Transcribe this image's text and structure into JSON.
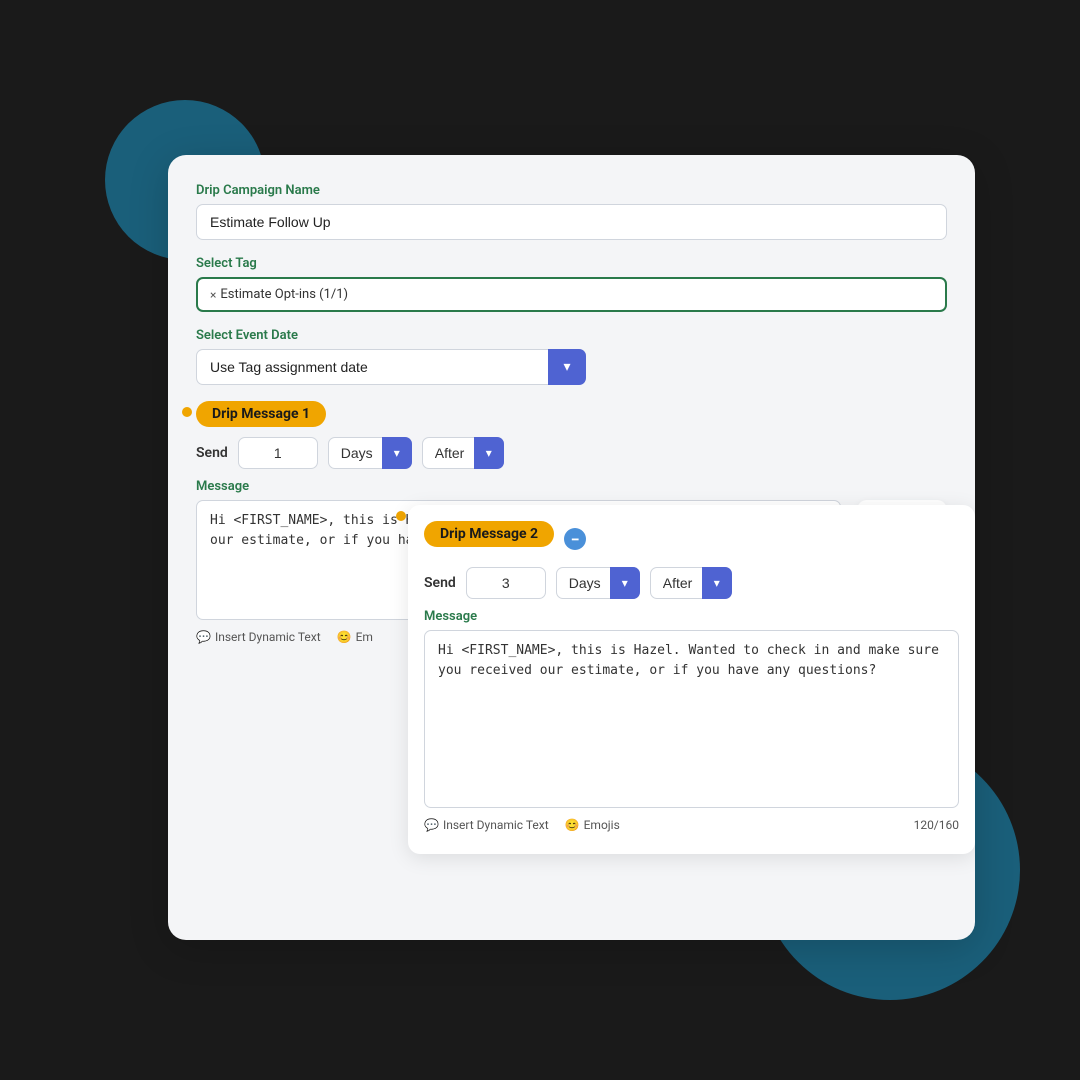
{
  "background": {
    "color": "#1a1a1a"
  },
  "form": {
    "drip_campaign_label": "Drip Campaign Name",
    "drip_campaign_value": "Estimate Follow Up",
    "select_tag_label": "Select Tag",
    "tag_value": "Estimate Opt-ins (1/1)",
    "select_event_date_label": "Select Event Date",
    "event_date_value": "Use Tag assignment date",
    "drip_message_1_label": "Drip Message 1",
    "drip_message_2_label": "Drip Message 2",
    "send_label": "Send",
    "send_value_1": "1",
    "send_value_2": "3",
    "days_label": "Days",
    "after_label": "After",
    "message_label": "Message",
    "message_text": "Hi <FIRST_NAME>, this is Hazel. Wanted to check in and make sure you received our estimate, or if you have any questions?",
    "insert_dynamic_text": "Insert Dynamic Text",
    "emojis": "Emojis",
    "char_count": "120/160"
  }
}
